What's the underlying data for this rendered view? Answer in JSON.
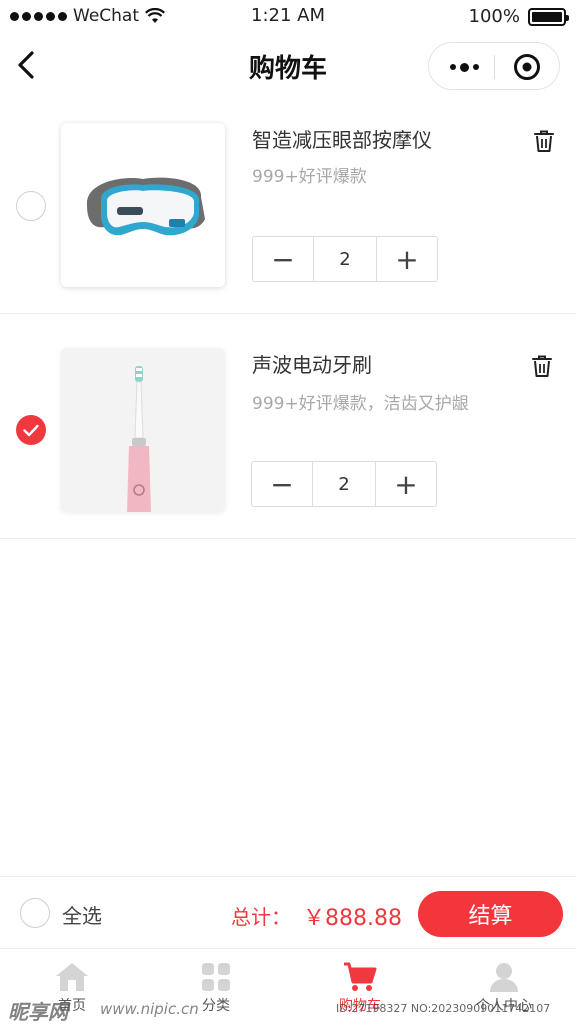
{
  "status_bar": {
    "carrier": "WeChat",
    "time": "1:21 AM",
    "battery": "100%",
    "battery_level": 1.0
  },
  "nav": {
    "title": "购物车"
  },
  "cart": {
    "items": [
      {
        "title": "智造减压眼部按摩仪",
        "subtitle": "999+好评爆款",
        "quantity": "2",
        "checked": false,
        "image": "eye-massager-image"
      },
      {
        "title": "声波电动牙刷",
        "subtitle": "999+好评爆款，洁齿又护龈",
        "quantity": "2",
        "checked": true,
        "image": "electric-toothbrush-image"
      }
    ],
    "decrement_symbol": "−",
    "increment_symbol": "+"
  },
  "checkout": {
    "select_all_label": "全选",
    "total_label": "总计：",
    "total_value": "￥888.88",
    "button_label": "结算"
  },
  "tabs": [
    {
      "label": "首页",
      "icon": "home-icon",
      "active": false
    },
    {
      "label": "分类",
      "icon": "category-icon",
      "active": false
    },
    {
      "label": "购物车",
      "icon": "cart-icon",
      "active": true
    },
    {
      "label": "个人中心",
      "icon": "user-icon",
      "active": false
    }
  ],
  "watermark": {
    "logo": "昵享网",
    "url": "www.nipic.cn",
    "id": "ID:27198327 NO:20230909011742107"
  },
  "colors": {
    "accent": "#f0393f",
    "text": "#333333",
    "muted": "#a8a8a8",
    "border": "#dcdcdc"
  }
}
